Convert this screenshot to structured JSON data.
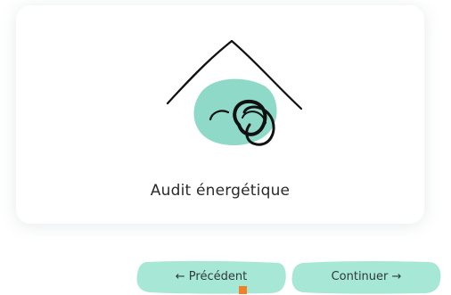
{
  "card": {
    "label": "Audit énergétique",
    "illustration_icon": "house-energy-audit-icon"
  },
  "navigation": {
    "previous_label": "← Précédent",
    "next_label": "Continuer →"
  },
  "colors": {
    "accent_teal": "#8ed9c7",
    "button_fill": "#a7e7d6",
    "stroke": "#111111",
    "cursor_marker": "#f0802a"
  }
}
